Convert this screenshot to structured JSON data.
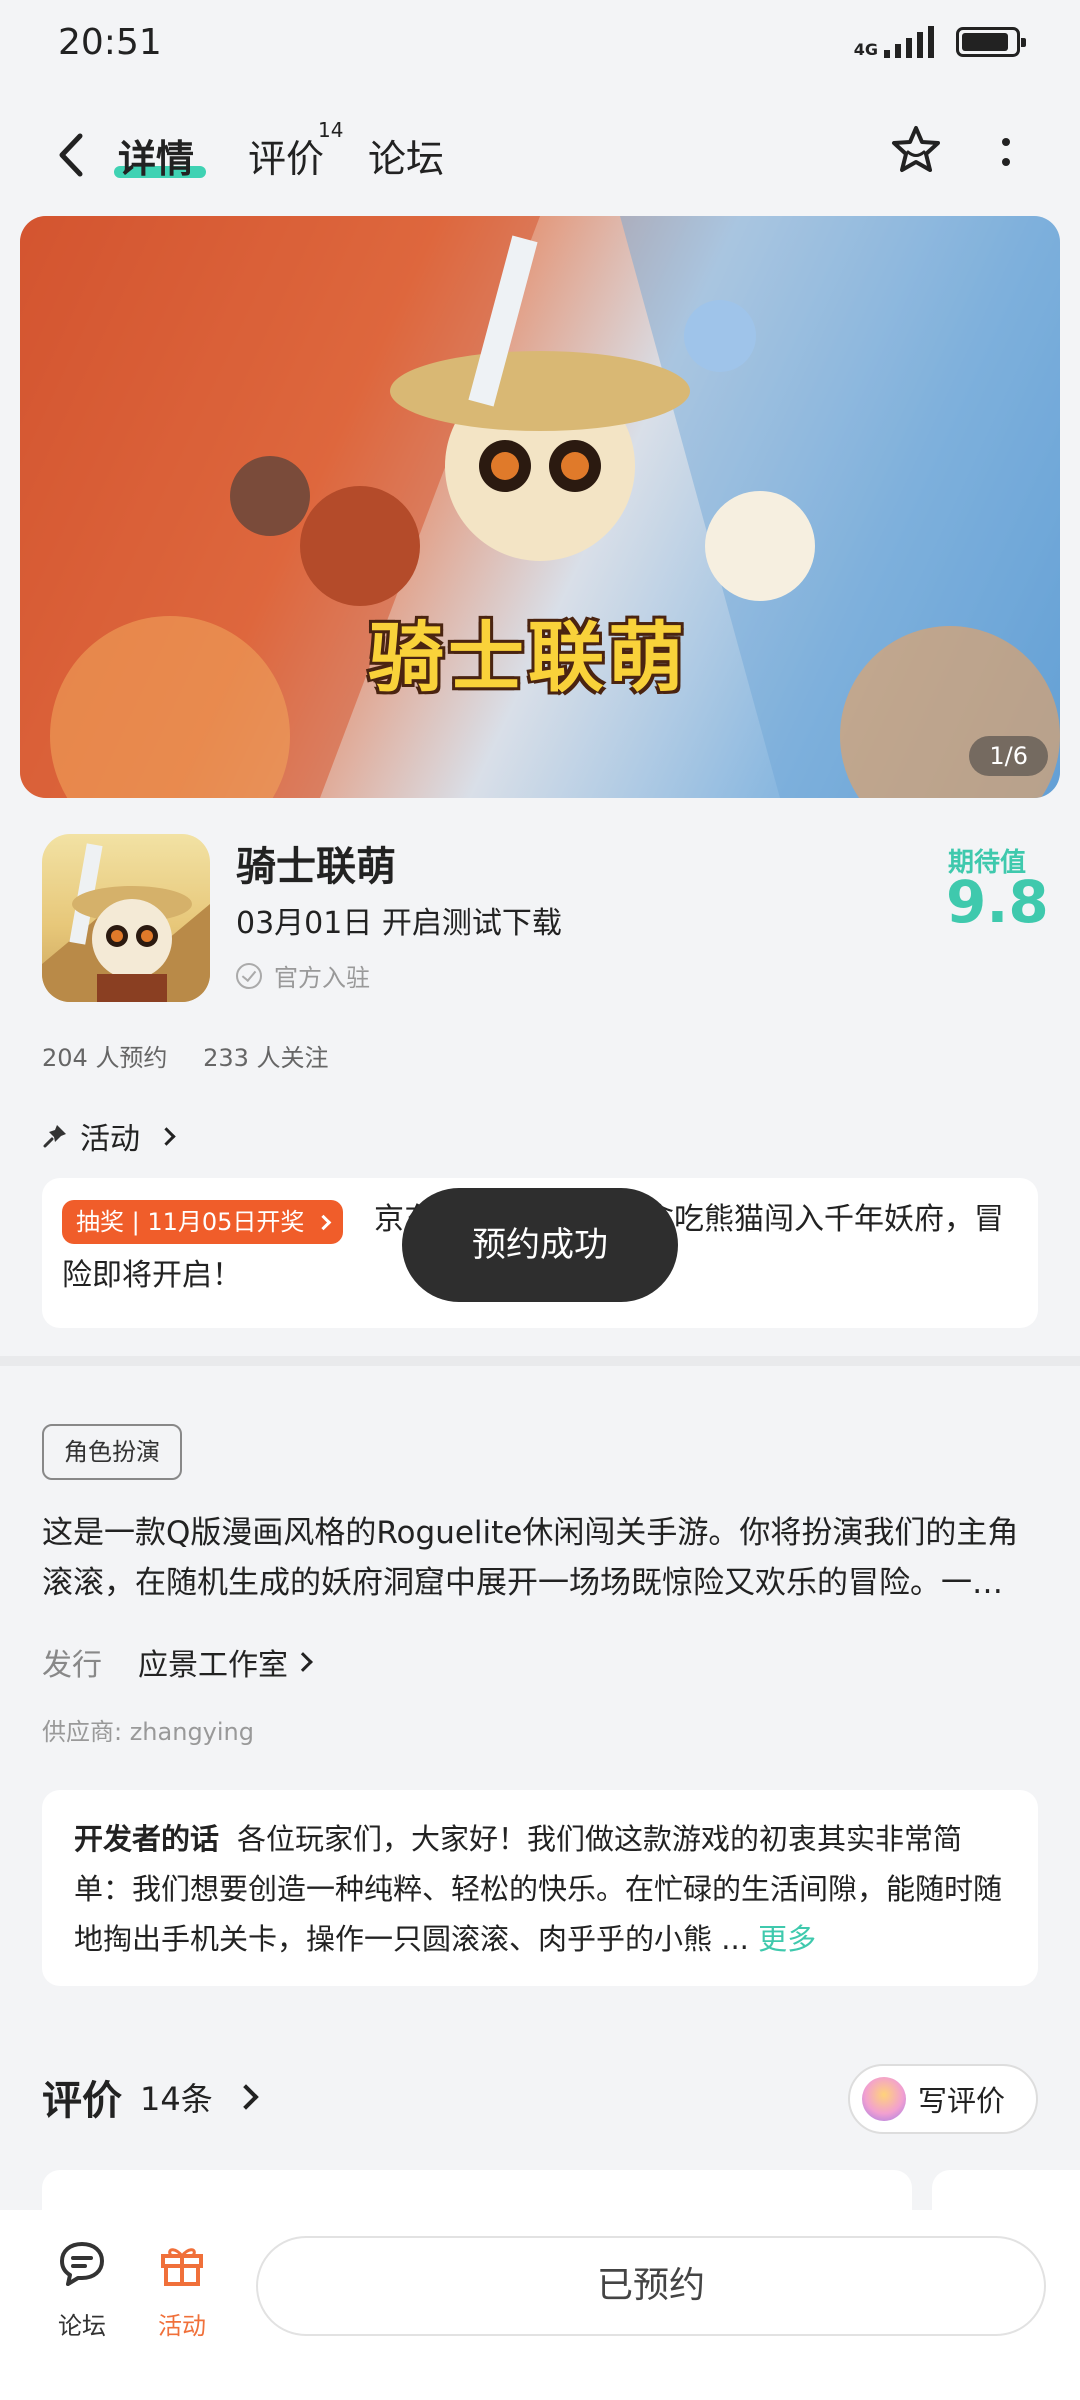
{
  "status_bar": {
    "time": "20:51",
    "network": "4G"
  },
  "nav": {
    "tabs": [
      {
        "label": "详情"
      },
      {
        "label": "评价",
        "count": "14"
      },
      {
        "label": "论坛"
      }
    ]
  },
  "banner": {
    "logo_text": "骑士联萌",
    "page_indicator": "1/6"
  },
  "app": {
    "name": "骑士联萌",
    "release": "03月01日 开启测试下载",
    "verified": "官方入驻",
    "expect_label": "期待值",
    "expect_score": "9.8"
  },
  "stats": {
    "reservations": "204 人预约",
    "followers": "233 人关注"
  },
  "activity": {
    "title": "活动",
    "badge": "抽奖 | 11月05日开奖",
    "text": "京东卡【上线公告】贪吃熊猫闯入千年妖府，冒险即将开启！"
  },
  "toast": "预约成功",
  "genre_tag": "角色扮演",
  "description": "这是一款Q版漫画风格的Roguelite休闲闯关手游。你将扮演我们的主角滚滚，在随机生成的妖府洞窟中展开一场场既惊险又欢乐的冒险。一…",
  "publisher": {
    "label": "发行",
    "name": "应景工作室"
  },
  "supplier": "供应商: zhangying",
  "developer_note": {
    "label": "开发者的话",
    "text": "各位玩家们，大家好！我们做这款游戏的初衷其实非常简单：我们想要创造一种纯粹、轻松的快乐。在忙碌的生活间隙，能随时随地掏出手机关卡，操作一只圆滚滚、肉乎乎的小熊 ...",
    "more": "更多"
  },
  "reviews": {
    "title": "评价",
    "count": "14条",
    "write_button": "写评价"
  },
  "bottom_bar": {
    "forum_label": "论坛",
    "activity_label": "活动",
    "reserved_button": "已预约"
  },
  "colors": {
    "accent": "#3fc9ad",
    "orange": "#f05d2a",
    "toast_bg": "#2e2e2e"
  }
}
